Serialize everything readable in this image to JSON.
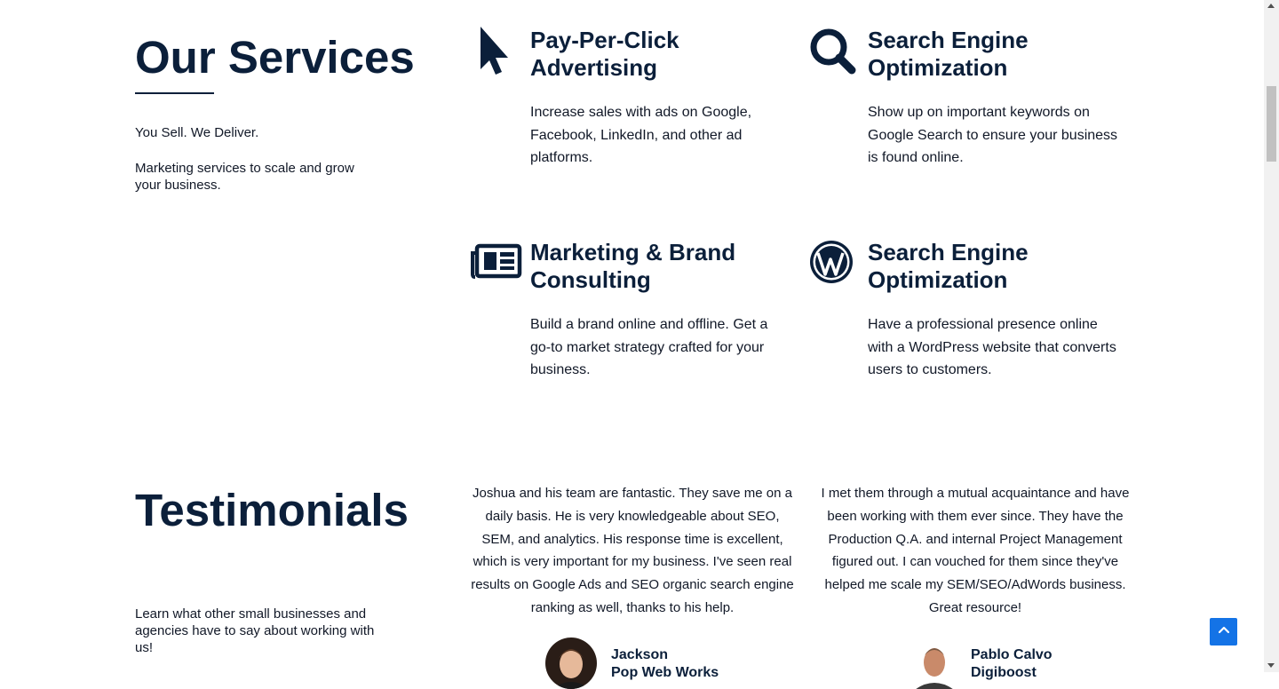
{
  "services": {
    "title": "Our Services",
    "tagline": "You Sell. We Deliver.",
    "description": "Marketing services to scale and grow your business.",
    "items": [
      {
        "icon": "cursor-pointer-icon",
        "title": "Pay-Per-Click Advertising",
        "text": "Increase sales with ads on Google, Facebook, LinkedIn, and other ad platforms."
      },
      {
        "icon": "search-icon",
        "title": "Search Engine Optimization",
        "text": "Show up on important keywords on Google Search to ensure your business is found online."
      },
      {
        "icon": "newspaper-icon",
        "title": "Marketing & Brand Consulting",
        "text": "Build a brand online and offline. Get a go-to market strategy crafted for your business."
      },
      {
        "icon": "wordpress-icon",
        "title": "Search Engine Optimization",
        "text": "Have a professional presence online with a WordPress website that converts users to customers."
      }
    ]
  },
  "testimonials": {
    "title": "Testimonials",
    "description": "Learn what other small businesses and agencies have to say about working with us!",
    "items": [
      {
        "quote": "Joshua and his team are fantastic. They save me on a daily basis. He is very knowledgeable about SEO, SEM, and analytics. His response time is excellent, which is very important for my business. I've seen real results on Google Ads and SEO organic search engine ranking as well, thanks to his help.",
        "name": "Jackson",
        "company": "Pop Web Works"
      },
      {
        "quote": "I met them through a mutual acquaintance and have been working with them ever since. They have the Production Q.A. and internal Project Management figured out. I can vouched for them since they've helped me scale my SEM/SEO/AdWords business. Great resource!",
        "name": "Pablo Calvo",
        "company": "Digiboost"
      }
    ]
  },
  "colors": {
    "navy": "#0b1f3a",
    "accent": "#1473e6",
    "text": "#111827"
  },
  "scroll_to_top": {
    "icon": "chevron-up-icon"
  }
}
